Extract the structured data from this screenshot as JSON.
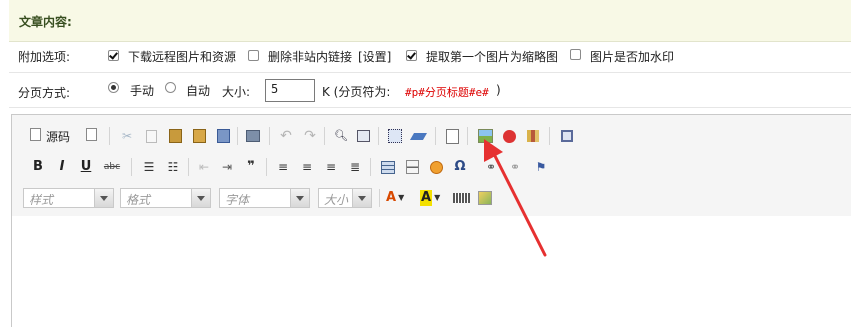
{
  "section": {
    "title": "文章内容:"
  },
  "options_row": {
    "label": "附加选项:",
    "options": [
      {
        "label": "下载远程图片和资源",
        "checked": true
      },
      {
        "label": "删除非站内链接",
        "checked": false,
        "link_text": "[设置]"
      },
      {
        "label": "提取第一个图片为缩略图",
        "checked": true
      },
      {
        "label": "图片是否加水印",
        "checked": false
      }
    ]
  },
  "pagination_row": {
    "label": "分页方式:",
    "modes": [
      {
        "label": "手动",
        "selected": true
      },
      {
        "label": "自动",
        "selected": false
      }
    ],
    "size_label": "大小:",
    "size_value": "5",
    "unit_text": "K (分页符为:",
    "example": "#p#分页标题#e#",
    "close_paren": ")"
  },
  "editor": {
    "source_label": "源码",
    "combos": [
      {
        "name": "style-combo",
        "placeholder": "样式"
      },
      {
        "name": "format-combo",
        "placeholder": "格式"
      },
      {
        "name": "font-combo",
        "placeholder": "字体"
      },
      {
        "name": "size-combo",
        "placeholder": "大小"
      }
    ],
    "icons_row1": [
      "source-icon",
      "preview-icon",
      "cut-icon",
      "copy-icon",
      "paste-icon",
      "paste-text-icon",
      "paste-word-icon",
      "print-icon",
      "undo-icon",
      "redo-icon",
      "find-icon",
      "replace-icon",
      "select-all-icon",
      "remove-format-icon",
      "page-break-icon",
      "image-icon",
      "flash-icon",
      "multimedia-icon",
      "maximize-icon"
    ],
    "icons_row2": [
      "bold-icon",
      "italic-icon",
      "underline-icon",
      "strikethrough-icon",
      "numbered-list-icon",
      "bulleted-list-icon",
      "outdent-icon",
      "indent-icon",
      "blockquote-icon",
      "align-left-icon",
      "align-center-icon",
      "align-right-icon",
      "justify-icon",
      "table-icon",
      "horizontal-rule-icon",
      "smiley-icon",
      "special-char-icon",
      "link-icon",
      "unlink-icon",
      "anchor-icon"
    ],
    "icons_row3": [
      "text-color-icon",
      "background-color-icon",
      "code-icon",
      "image-upload-icon"
    ],
    "glyphs": {
      "bold": "B",
      "italic": "I",
      "underline": "U",
      "strike": "abc",
      "omega": "Ω",
      "blockquote": "❞",
      "text_color": "A",
      "bg_color": "A"
    }
  },
  "colors": {
    "header_bg": "#f8f9e6",
    "header_text": "#384f20",
    "example_red": "#dd0000",
    "arrow_red": "#e63030"
  }
}
